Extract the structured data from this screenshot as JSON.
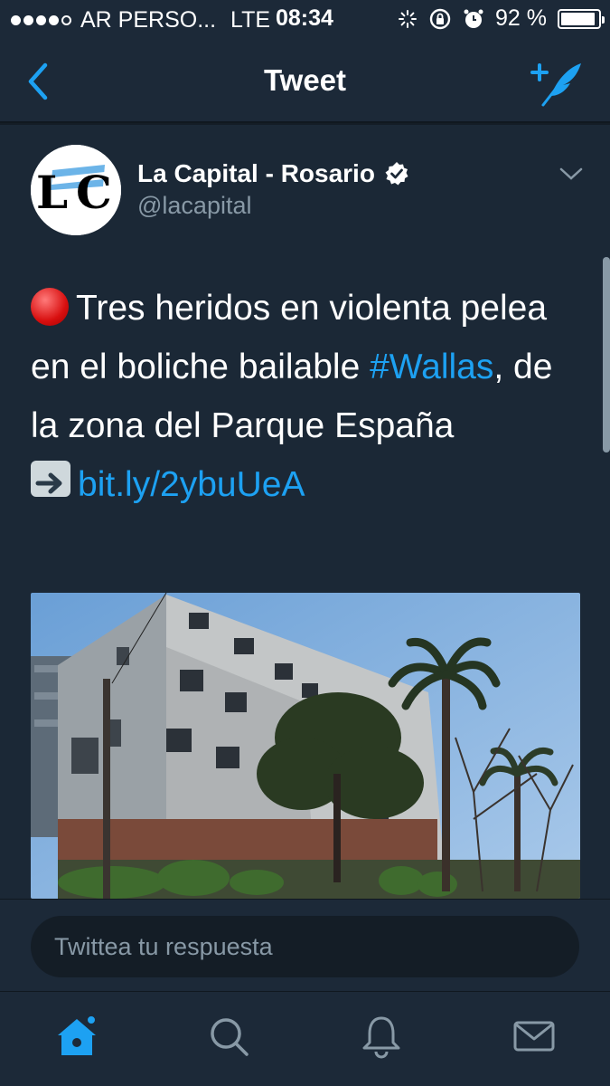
{
  "status_bar": {
    "carrier": "AR PERSO...",
    "network": "LTE",
    "time": "08:34",
    "battery": "92 %",
    "battery_level": 0.92
  },
  "nav": {
    "title": "Tweet",
    "back_icon": "chevron-left-icon",
    "compose_icon": "compose-tweet-icon"
  },
  "tweet": {
    "author_name": "La Capital - Rosario",
    "author_handle": "@lacapital",
    "avatar_text": "LC",
    "text_1": "Tres heridos en violenta pelea en el boliche bailable ",
    "hashtag": "#Wallas",
    "text_2": ", de la zona del Parque España",
    "link": "bit.ly/2ybuUeA"
  },
  "reply": {
    "placeholder": "Twittea tu respuesta"
  },
  "tabs": [
    {
      "icon": "home-icon",
      "active": true
    },
    {
      "icon": "search-icon",
      "active": false
    },
    {
      "icon": "notifications-icon",
      "active": false
    },
    {
      "icon": "messages-icon",
      "active": false
    }
  ],
  "colors": {
    "accent": "#1da1f2",
    "background": "#141d26",
    "bar": "#1c2938",
    "muted": "#8899a6"
  }
}
